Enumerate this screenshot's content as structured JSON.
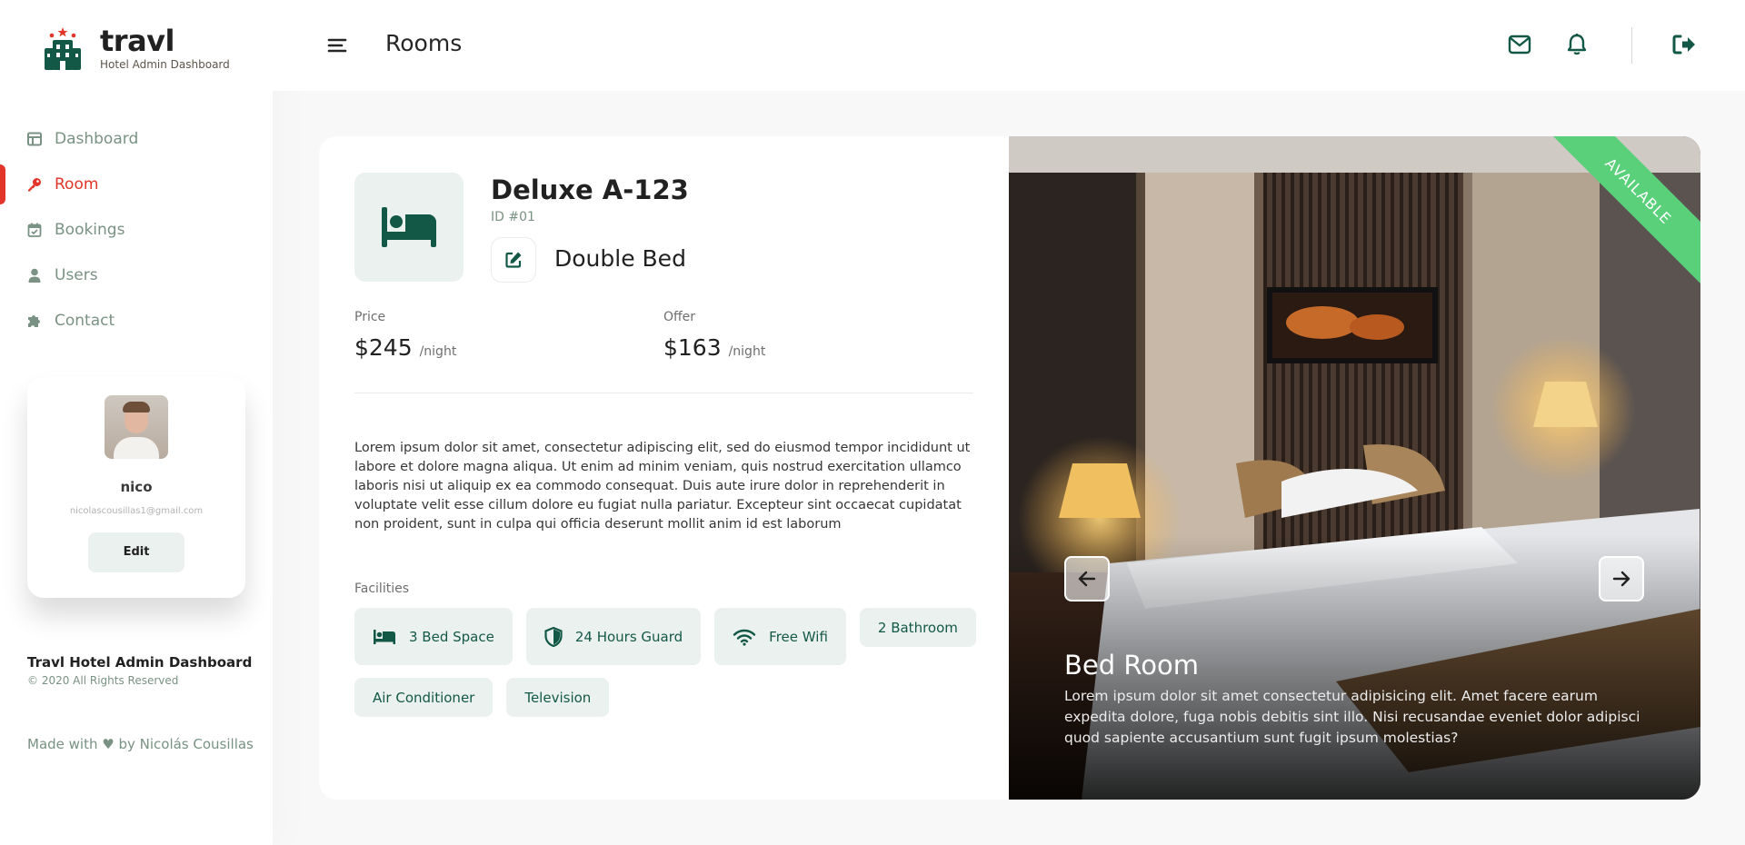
{
  "brand": {
    "name": "travl",
    "subtitle": "Hotel Admin Dashboard"
  },
  "sidebar": {
    "items": [
      {
        "label": "Dashboard",
        "icon": "dashboard-icon",
        "active": false
      },
      {
        "label": "Room",
        "icon": "key-icon",
        "active": true
      },
      {
        "label": "Bookings",
        "icon": "calendar-check-icon",
        "active": false
      },
      {
        "label": "Users",
        "icon": "user-icon",
        "active": false
      },
      {
        "label": "Contact",
        "icon": "puzzle-icon",
        "active": false
      }
    ],
    "user": {
      "name": "nico",
      "email": "nicolascousillas1@gmail.com",
      "edit_label": "Edit"
    },
    "footer": {
      "title": "Travl Hotel Admin Dashboard",
      "copyright": "© 2020 All Rights Reserved",
      "made_with": "Made with ♥ by Nicolás Cousillas"
    }
  },
  "header": {
    "title": "Rooms"
  },
  "room": {
    "name": "Deluxe A-123",
    "id": "ID #01",
    "bed_type": "Double Bed",
    "price_label": "Price",
    "price": "$245",
    "offer_label": "Offer",
    "offer": "$163",
    "per_night": "/night",
    "description": "Lorem ipsum dolor sit amet, consectetur adipiscing elit, sed do eiusmod tempor incididunt ut labore et dolore magna aliqua. Ut enim ad minim veniam, quis nostrud exercitation ullamco laboris nisi ut aliquip ex ea commodo consequat. Duis aute irure dolor in reprehenderit in voluptate velit esse cillum dolore eu fugiat nulla pariatur. Excepteur sint occaecat cupidatat non proident, sunt in culpa qui officia deserunt mollit anim id est laborum",
    "facilities_label": "Facilities",
    "facilities": [
      "3 Bed Space",
      "24 Hours Guard",
      "Free Wifi",
      "2 Bathroom",
      "Air Conditioner",
      "Television"
    ],
    "status": "AVAILABLE",
    "photo_title": "Bed Room",
    "photo_desc": "Lorem ipsum dolor sit amet consectetur adipisicing elit. Amet facere earum expedita dolore, fuga nobis debitis sint illo. Nisi recusandae eveniet dolor adipisci quod sapiente accusantium sunt fugit ipsum molestias?"
  },
  "colors": {
    "primary": "#135846",
    "accent": "#e23428",
    "muted": "#799283",
    "available": "#5ad07a",
    "chip_bg": "#ebf1ef"
  }
}
